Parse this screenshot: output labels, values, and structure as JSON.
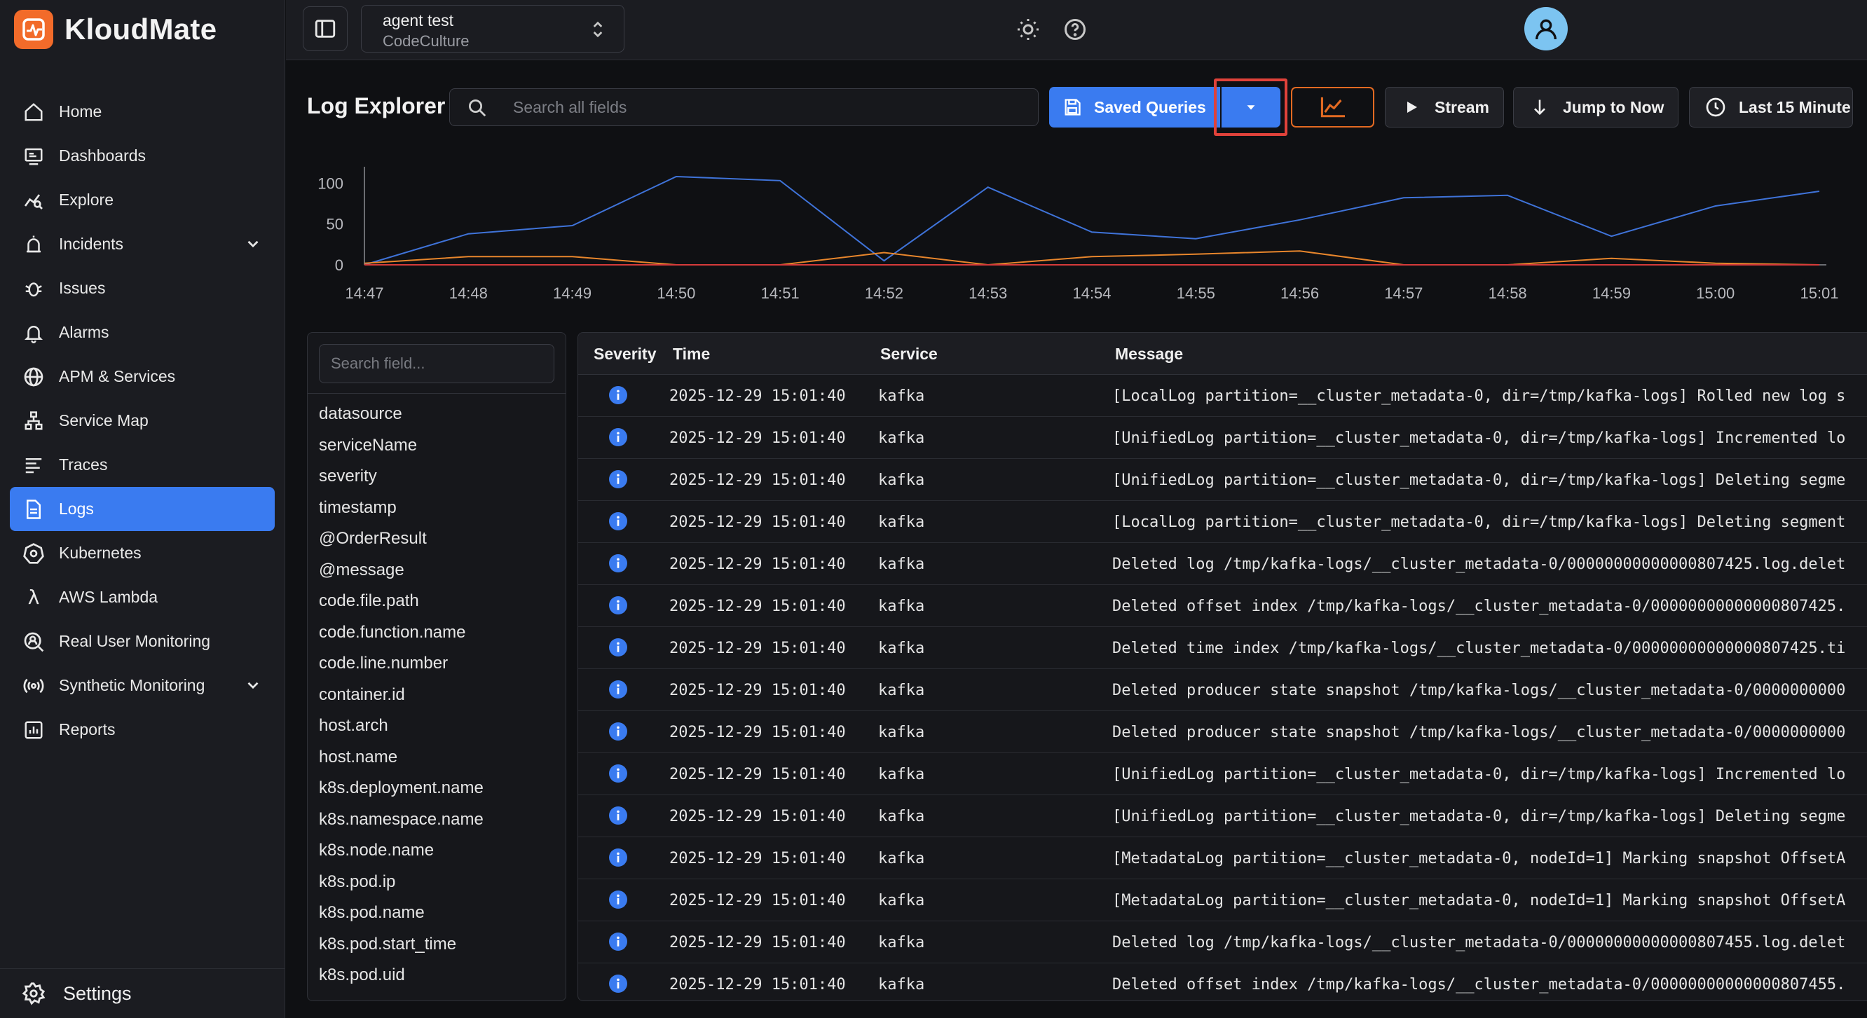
{
  "brand": {
    "name": "KloudMate"
  },
  "sidebar": {
    "items": [
      {
        "label": "Home",
        "icon": "home-icon"
      },
      {
        "label": "Dashboards",
        "icon": "dashboard-icon"
      },
      {
        "label": "Explore",
        "icon": "explore-icon"
      },
      {
        "label": "Incidents",
        "icon": "incident-icon"
      },
      {
        "label": "Issues",
        "icon": "bug-icon"
      },
      {
        "label": "Alarms",
        "icon": "alarm-icon"
      },
      {
        "label": "APM & Services",
        "icon": "globe-icon"
      },
      {
        "label": "Service Map",
        "icon": "service-map-icon"
      },
      {
        "label": "Traces",
        "icon": "traces-icon"
      },
      {
        "label": "Logs",
        "icon": "logs-icon"
      },
      {
        "label": "Kubernetes",
        "icon": "kubernetes-icon"
      },
      {
        "label": "AWS Lambda",
        "icon": "lambda-icon"
      },
      {
        "label": "Real User Monitoring",
        "icon": "rum-icon"
      },
      {
        "label": "Synthetic Monitoring",
        "icon": "synthetic-icon"
      },
      {
        "label": "Reports",
        "icon": "reports-icon"
      }
    ],
    "active": "Logs",
    "settings_label": "Settings"
  },
  "topbar": {
    "project_name": "agent test",
    "project_org": "CodeCulture"
  },
  "toolbar": {
    "title": "Log Explorer",
    "search_placeholder": "Search all fields",
    "saved_queries_label": "Saved Queries",
    "stream_label": "Stream",
    "jump_label": "Jump to Now",
    "time_range_label": "Last 15 Minute"
  },
  "colors": {
    "accent": "#3a7bf0",
    "orange": "#e36a22",
    "highlight": "#e0423a"
  },
  "chart_data": {
    "type": "line",
    "x": [
      "14:47",
      "14:48",
      "14:49",
      "14:50",
      "14:51",
      "14:52",
      "14:53",
      "14:54",
      "14:55",
      "14:56",
      "14:57",
      "14:58",
      "14:59",
      "15:00",
      "15:01"
    ],
    "ylim": [
      0,
      120
    ],
    "yticks": [
      0,
      50,
      100
    ],
    "series": [
      {
        "color": "#3f73d9",
        "values": [
          0,
          38,
          48,
          108,
          103,
          5,
          95,
          40,
          32,
          55,
          82,
          85,
          35,
          72,
          90
        ]
      },
      {
        "color": "#e8862c",
        "values": [
          2,
          10,
          10,
          0,
          0,
          15,
          0,
          10,
          13,
          17,
          0,
          0,
          8,
          2,
          0
        ]
      },
      {
        "color": "#d63b3b",
        "values": [
          0,
          0,
          0,
          0,
          0,
          0,
          0,
          0,
          0,
          0,
          0,
          0,
          0,
          0,
          0
        ]
      }
    ]
  },
  "fields": {
    "search_placeholder": "Search field...",
    "items": [
      "datasource",
      "serviceName",
      "severity",
      "timestamp",
      "@OrderResult",
      "@message",
      "code.file.path",
      "code.function.name",
      "code.line.number",
      "container.id",
      "host.arch",
      "host.name",
      "k8s.deployment.name",
      "k8s.namespace.name",
      "k8s.node.name",
      "k8s.pod.ip",
      "k8s.pod.name",
      "k8s.pod.start_time",
      "k8s.pod.uid"
    ]
  },
  "table": {
    "headers": {
      "severity": "Severity",
      "time": "Time",
      "service": "Service",
      "message": "Message"
    },
    "rows": [
      {
        "time": "2025-12-29 15:01:40",
        "service": "kafka",
        "message": "[LocalLog partition=__cluster_metadata-0, dir=/tmp/kafka-logs] Rolled new log s"
      },
      {
        "time": "2025-12-29 15:01:40",
        "service": "kafka",
        "message": "[UnifiedLog partition=__cluster_metadata-0, dir=/tmp/kafka-logs] Incremented lo"
      },
      {
        "time": "2025-12-29 15:01:40",
        "service": "kafka",
        "message": "[UnifiedLog partition=__cluster_metadata-0, dir=/tmp/kafka-logs] Deleting segme"
      },
      {
        "time": "2025-12-29 15:01:40",
        "service": "kafka",
        "message": "[LocalLog partition=__cluster_metadata-0, dir=/tmp/kafka-logs] Deleting segment"
      },
      {
        "time": "2025-12-29 15:01:40",
        "service": "kafka",
        "message": "Deleted log /tmp/kafka-logs/__cluster_metadata-0/00000000000000807425.log.delet"
      },
      {
        "time": "2025-12-29 15:01:40",
        "service": "kafka",
        "message": "Deleted offset index /tmp/kafka-logs/__cluster_metadata-0/00000000000000807425."
      },
      {
        "time": "2025-12-29 15:01:40",
        "service": "kafka",
        "message": "Deleted time index /tmp/kafka-logs/__cluster_metadata-0/00000000000000807425.ti"
      },
      {
        "time": "2025-12-29 15:01:40",
        "service": "kafka",
        "message": "Deleted producer state snapshot /tmp/kafka-logs/__cluster_metadata-0/0000000000"
      },
      {
        "time": "2025-12-29 15:01:40",
        "service": "kafka",
        "message": "Deleted producer state snapshot /tmp/kafka-logs/__cluster_metadata-0/0000000000"
      },
      {
        "time": "2025-12-29 15:01:40",
        "service": "kafka",
        "message": "[UnifiedLog partition=__cluster_metadata-0, dir=/tmp/kafka-logs] Incremented lo"
      },
      {
        "time": "2025-12-29 15:01:40",
        "service": "kafka",
        "message": "[UnifiedLog partition=__cluster_metadata-0, dir=/tmp/kafka-logs] Deleting segme"
      },
      {
        "time": "2025-12-29 15:01:40",
        "service": "kafka",
        "message": "[MetadataLog partition=__cluster_metadata-0, nodeId=1] Marking snapshot OffsetA"
      },
      {
        "time": "2025-12-29 15:01:40",
        "service": "kafka",
        "message": "[MetadataLog partition=__cluster_metadata-0, nodeId=1] Marking snapshot OffsetA"
      },
      {
        "time": "2025-12-29 15:01:40",
        "service": "kafka",
        "message": "Deleted log /tmp/kafka-logs/__cluster_metadata-0/00000000000000807455.log.delet"
      },
      {
        "time": "2025-12-29 15:01:40",
        "service": "kafka",
        "message": "Deleted offset index /tmp/kafka-logs/__cluster_metadata-0/00000000000000807455."
      }
    ]
  }
}
